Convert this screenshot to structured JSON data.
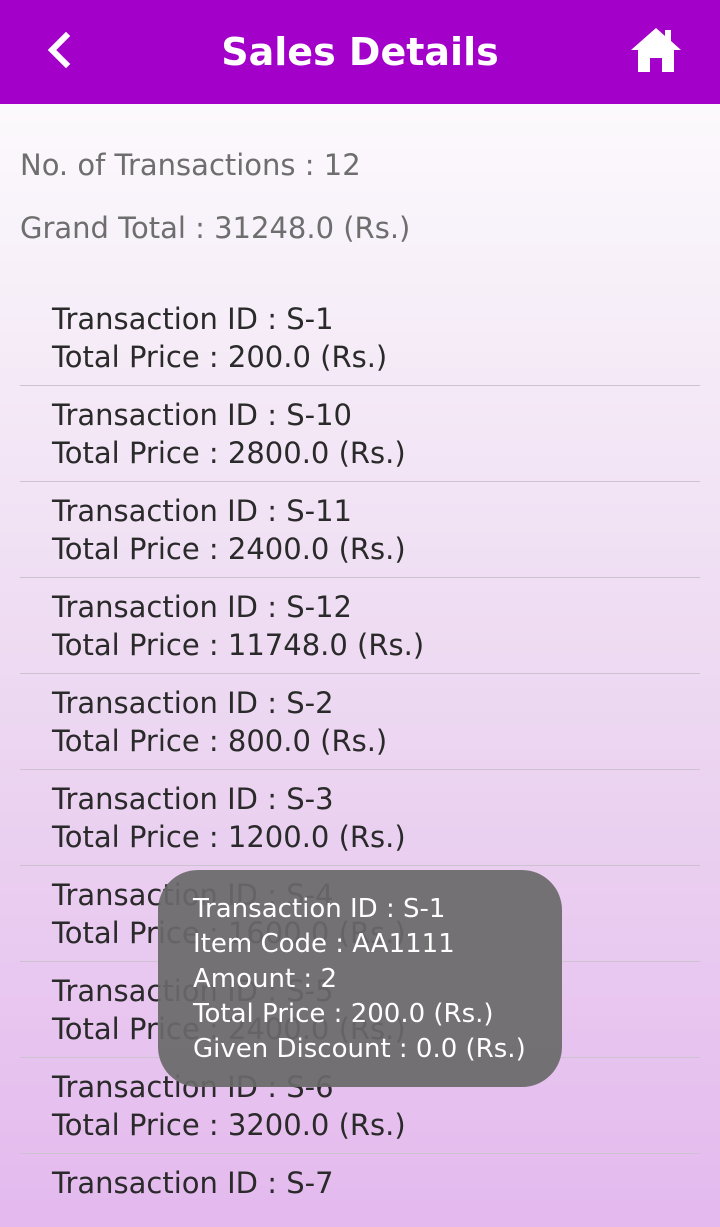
{
  "header": {
    "title": "Sales Details",
    "back_icon": "chevron-left-icon",
    "home_icon": "home-icon",
    "background_color": "#a300c9"
  },
  "summary": {
    "transactions": "No. of Transactions : 12",
    "grand_total": "Grand Total : 31248.0 (Rs.)"
  },
  "transactions": [
    {
      "id": "Transaction ID : S-1",
      "price": "Total Price : 200.0 (Rs.)"
    },
    {
      "id": "Transaction ID : S-10",
      "price": "Total Price : 2800.0 (Rs.)"
    },
    {
      "id": "Transaction ID : S-11",
      "price": "Total Price : 2400.0 (Rs.)"
    },
    {
      "id": "Transaction ID : S-12",
      "price": "Total Price : 11748.0 (Rs.)"
    },
    {
      "id": "Transaction ID : S-2",
      "price": "Total Price : 800.0 (Rs.)"
    },
    {
      "id": "Transaction ID : S-3",
      "price": "Total Price : 1200.0 (Rs.)"
    },
    {
      "id": "Transaction ID : S-4",
      "price": "Total Price : 1600.0 (Rs.)"
    },
    {
      "id": "Transaction ID : S-5",
      "price": "Total Price : 2400.0 (Rs.)"
    },
    {
      "id": "Transaction ID : S-6",
      "price": "Total Price : 3200.0 (Rs.)"
    },
    {
      "id": "Transaction ID : S-7",
      "price": ""
    }
  ],
  "toast": {
    "lines": [
      "Transaction ID : S-1",
      "Item Code : AA1111",
      "Amount : 2",
      "Total Price : 200.0 (Rs.)",
      "Given Discount : 0.0 (Rs.)"
    ]
  }
}
